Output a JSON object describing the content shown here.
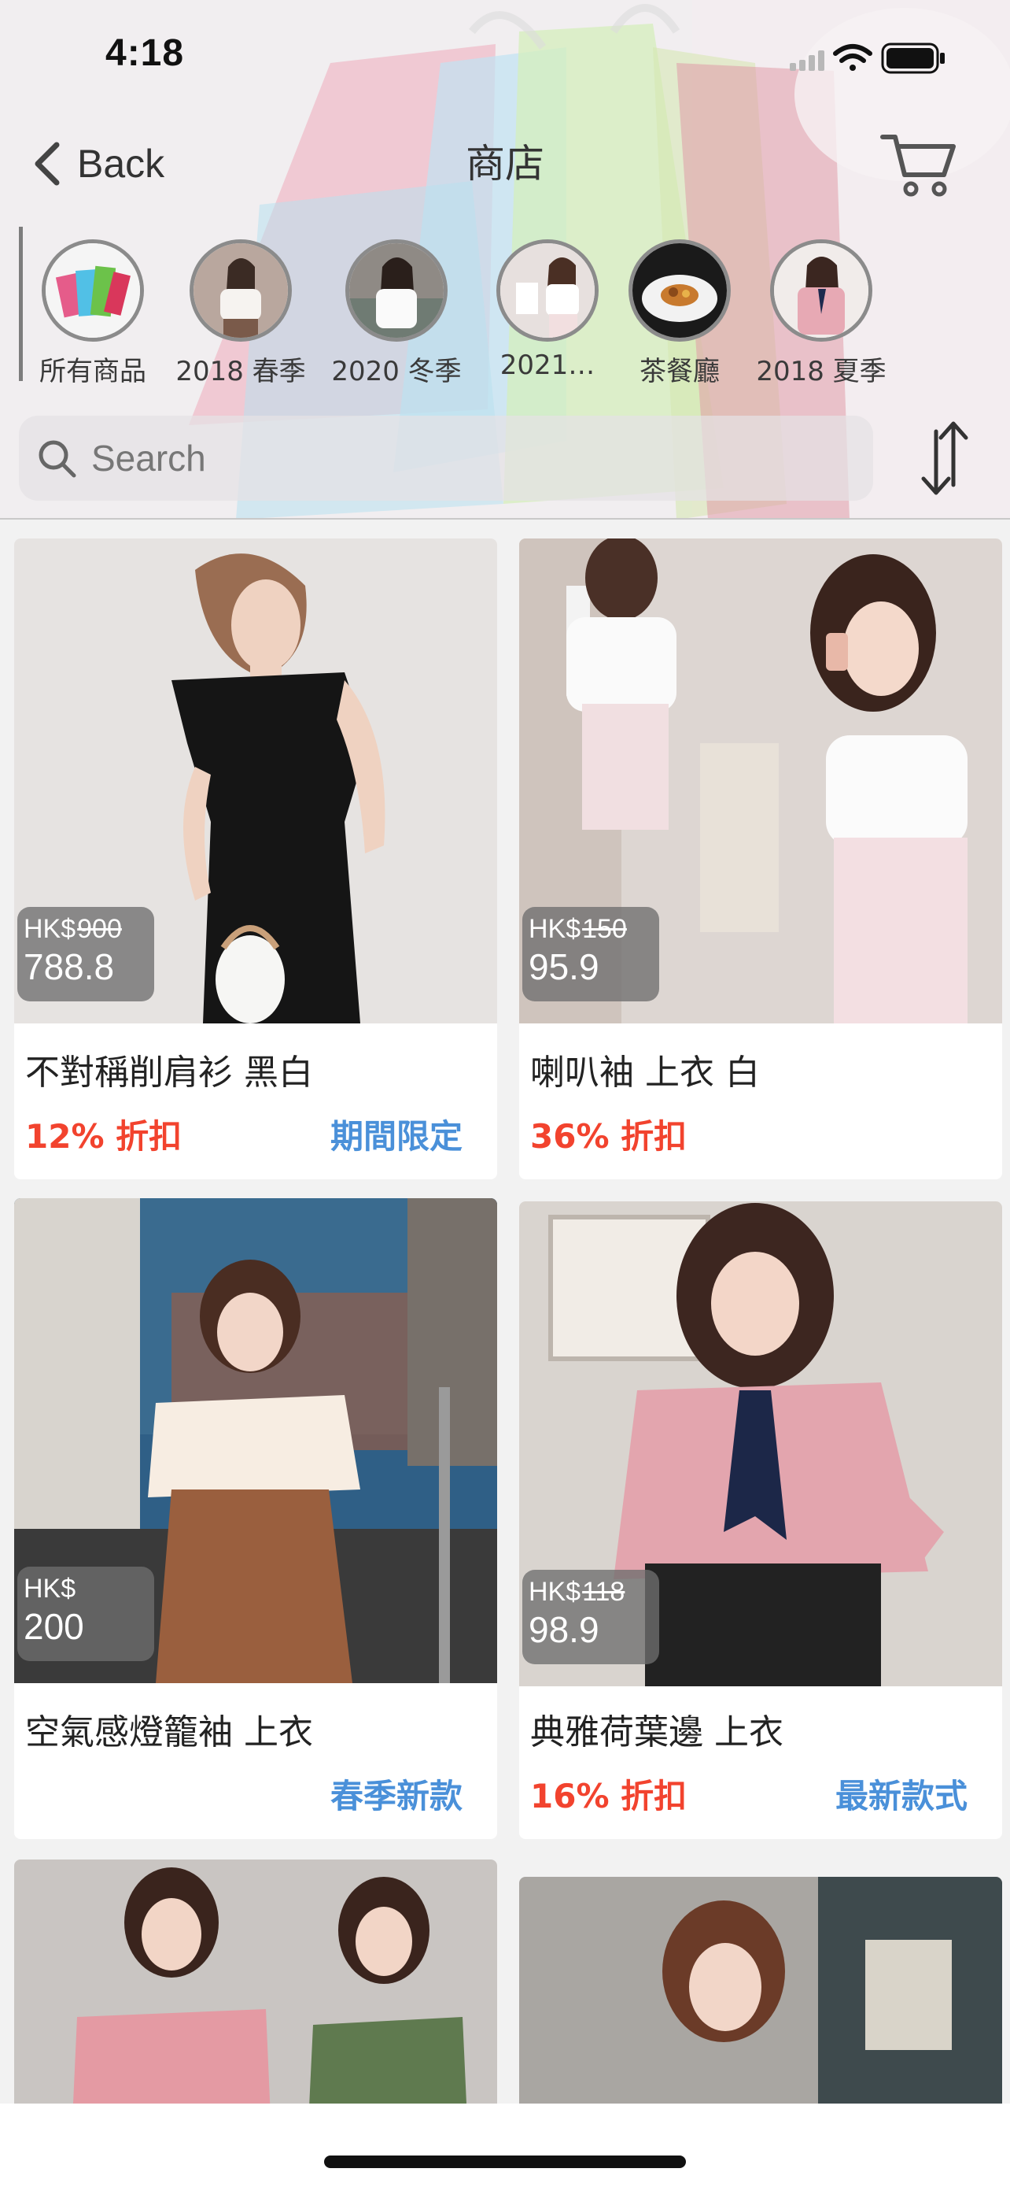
{
  "status_bar": {
    "time": "4:18"
  },
  "nav": {
    "back_label": "Back",
    "title": "商店"
  },
  "categories": [
    {
      "label": "所有商品",
      "icon": "shopping-bags-thumbnail"
    },
    {
      "label": "2018 春季",
      "icon": "spring-2018-thumbnail"
    },
    {
      "label": "2020 冬季",
      "icon": "winter-2020-thumbnail"
    },
    {
      "label": "2021…",
      "icon": "season-2021-thumbnail"
    },
    {
      "label": "茶餐廳",
      "icon": "food-plate-thumbnail"
    },
    {
      "label": "2018 夏季",
      "icon": "summer-2018-thumbnail"
    }
  ],
  "search": {
    "placeholder": "Search",
    "value": ""
  },
  "products": [
    {
      "name": "不對稱削肩衫 黑白",
      "currency": "HK$",
      "original_price": "900",
      "price": "788.8",
      "discount": "12% 折扣",
      "badge": "期間限定"
    },
    {
      "name": "喇叭袖 上衣 白",
      "currency": "HK$",
      "original_price": "150",
      "price": "95.9",
      "discount": "36% 折扣",
      "badge": ""
    },
    {
      "name": "空氣感燈籠袖 上衣",
      "currency": "HK$",
      "original_price": "",
      "price": "200",
      "discount": "",
      "badge": "春季新款"
    },
    {
      "name": "典雅荷葉邊 上衣",
      "currency": "HK$",
      "original_price": "118",
      "price": "98.9",
      "discount": "16% 折扣",
      "badge": "最新款式"
    },
    {
      "name": "",
      "currency": "",
      "original_price": "",
      "price": "",
      "discount": "",
      "badge": ""
    },
    {
      "name": "",
      "currency": "",
      "original_price": "",
      "price": "",
      "discount": "",
      "badge": ""
    }
  ],
  "colors": {
    "discount": "#f2432e",
    "badge": "#4a90d9",
    "price_tag_bg": "#6e6e6e"
  }
}
